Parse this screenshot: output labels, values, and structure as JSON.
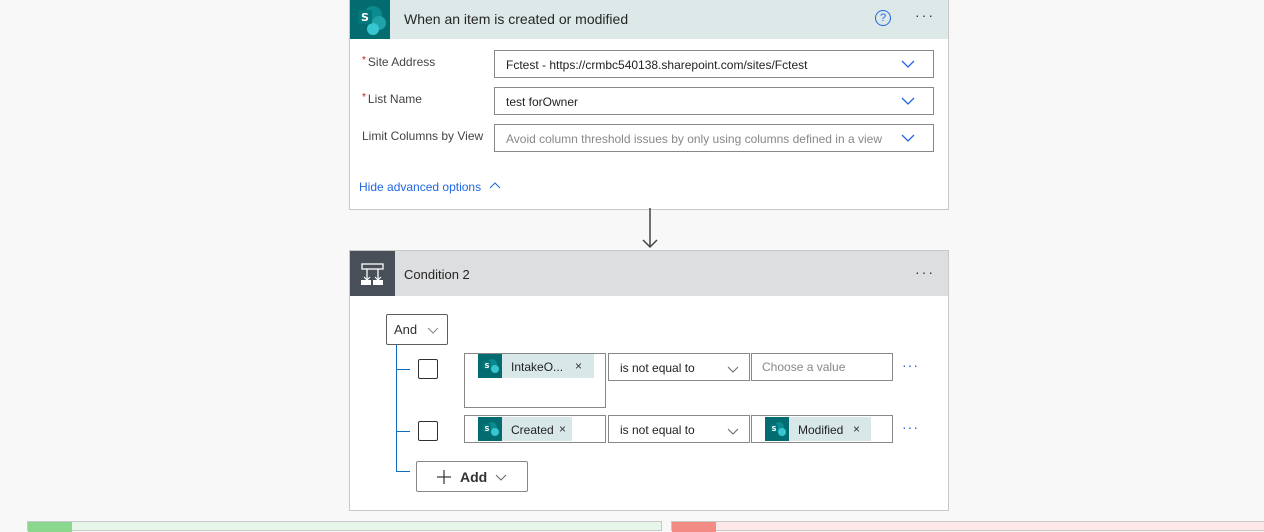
{
  "trigger": {
    "title": "When an item is created or modified",
    "help_icon": "?",
    "more_icon": "···",
    "fields": [
      {
        "label": "Site Address",
        "required": true,
        "value": "Fctest - https://crmbc540138.sharepoint.com/sites/Fctest"
      },
      {
        "label": "List Name",
        "required": true,
        "value": "test forOwner"
      },
      {
        "label": "Limit Columns by View",
        "required": false,
        "placeholder": "Avoid column threshold issues by only using columns defined in a view"
      }
    ],
    "required_mark": "*",
    "advanced_link": "Hide advanced options"
  },
  "condition": {
    "title": "Condition 2",
    "more_icon": "···",
    "group_operator": "And",
    "rows": [
      {
        "left_token": "IntakeO...",
        "operator": "is not equal to",
        "right_placeholder": "Choose a value",
        "right_token": null
      },
      {
        "left_token": "Created",
        "operator": "is not equal to",
        "right_placeholder": null,
        "right_token": "Modified"
      }
    ],
    "remove_icon": "×",
    "row_more_icon": "···",
    "add_label": "Add"
  },
  "colors": {
    "sharepoint": "#036c70",
    "trigger_header": "#dde9e9",
    "condition_icon_bg": "#484f58",
    "link": "#2266e3",
    "yes_accent": "#89d88d",
    "no_accent": "#f18b84"
  }
}
